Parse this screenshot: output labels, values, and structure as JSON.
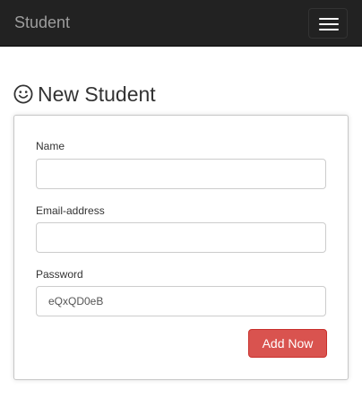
{
  "navbar": {
    "brand": "Student",
    "toggle_icon": "hamburger-menu-icon"
  },
  "page": {
    "title_icon": "smiley-icon",
    "title": "New Student"
  },
  "form": {
    "name_label": "Name",
    "name_value": "",
    "email_label": "Email-address",
    "email_value": "",
    "password_label": "Password",
    "password_value": "eQxQD0eB",
    "submit_label": "Add Now"
  },
  "colors": {
    "navbar_bg": "#222222",
    "brand_text": "#9d9d9d",
    "button_bg": "#d9534f"
  }
}
